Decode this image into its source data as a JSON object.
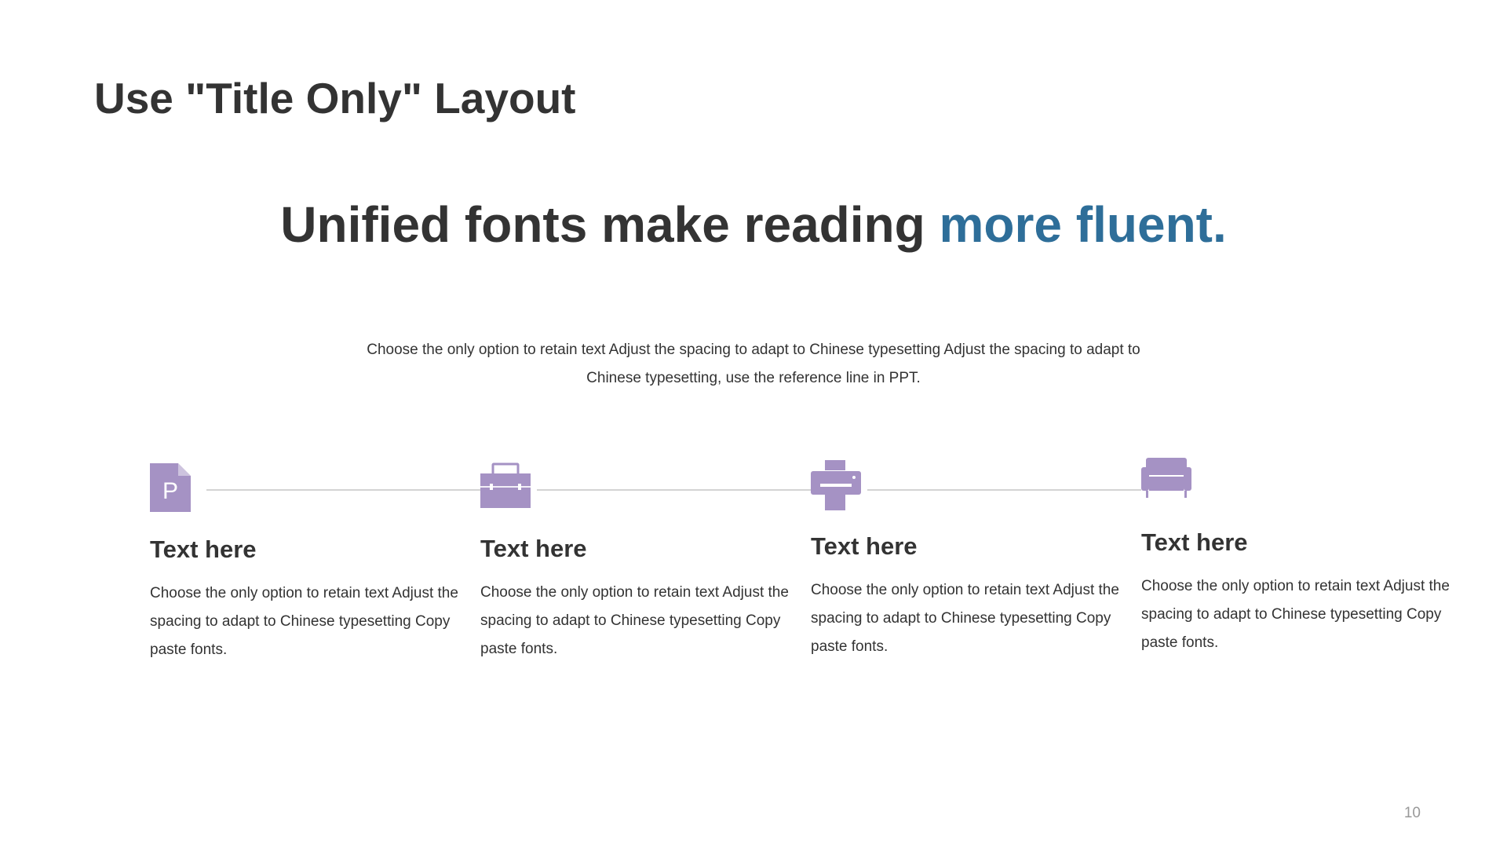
{
  "slide": {
    "title": "Use \"Title Only\" Layout",
    "headline_main": "Unified fonts make reading ",
    "headline_accent": "more fluent.",
    "intro": "Choose the only option to retain text Adjust the spacing to adapt to Chinese  typesetting Adjust the spacing to adapt to Chinese  typesetting, use the reference line in PPT.",
    "page_number": "10"
  },
  "colors": {
    "accent": "#2E6E99",
    "icon": "#A592C4",
    "text": "#333333",
    "line": "#D4D4D4"
  },
  "steps": [
    {
      "icon": "document-p-icon",
      "icon_letter": "P",
      "title": "Text here",
      "body": "Choose the only option to retain text Adjust the spacing to adapt to Chinese typesetting Copy paste fonts."
    },
    {
      "icon": "toolbox-icon",
      "title": "Text here",
      "body": "Choose the only option to retain text Adjust the spacing to adapt to Chinese typesetting Copy paste fonts."
    },
    {
      "icon": "printer-icon",
      "title": "Text here",
      "body": "Choose the only option to retain text Adjust the spacing to adapt to Chinese typesetting Copy paste fonts."
    },
    {
      "icon": "sofa-icon",
      "title": "Text here",
      "body": "Choose the only option to retain text Adjust the spacing to adapt to Chinese typesetting Copy paste fonts."
    }
  ]
}
